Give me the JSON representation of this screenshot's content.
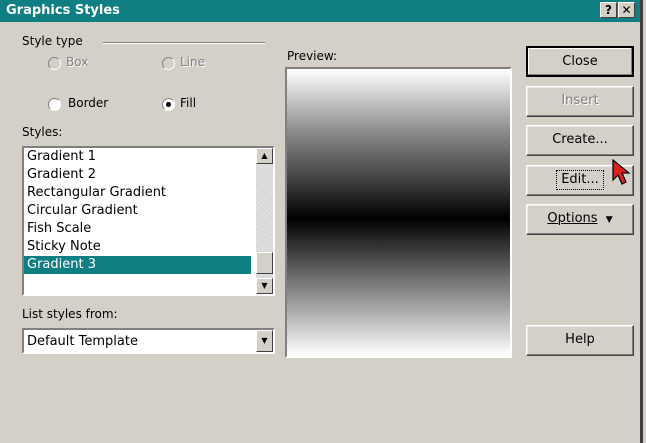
{
  "window": {
    "title": "Graphics Styles"
  },
  "titlebar_buttons": {
    "help": "?",
    "close": "✕"
  },
  "style_type": {
    "label": "Style type",
    "options": [
      {
        "label": "Box",
        "checked": false,
        "enabled": false
      },
      {
        "label": "Line",
        "checked": false,
        "enabled": false
      },
      {
        "label": "Border",
        "checked": false,
        "enabled": true
      },
      {
        "label": "Fill",
        "checked": true,
        "enabled": true
      }
    ]
  },
  "styles": {
    "label": "Styles:",
    "items": [
      "Gradient 1",
      "Gradient 2",
      "Rectangular Gradient",
      "Circular Gradient",
      "Fish Scale",
      "Sticky Note",
      "Gradient 3"
    ],
    "selected": "Gradient 3"
  },
  "list_styles_from": {
    "label": "List styles from:",
    "value": "Default Template"
  },
  "preview": {
    "label": "Preview:"
  },
  "buttons": {
    "close": "Close",
    "insert": "Insert",
    "create": "Create...",
    "edit": "Edit...",
    "options": "Options",
    "options_arrow": "▼",
    "help": "Help"
  },
  "icons": {
    "scroll_up": "▲",
    "scroll_down": "▼",
    "combo_arrow": "▼"
  },
  "colors": {
    "title_bar": "#0f7f83",
    "selection": "#0f7f83",
    "face": "#d4d0c8",
    "cursor": "#e02020"
  }
}
